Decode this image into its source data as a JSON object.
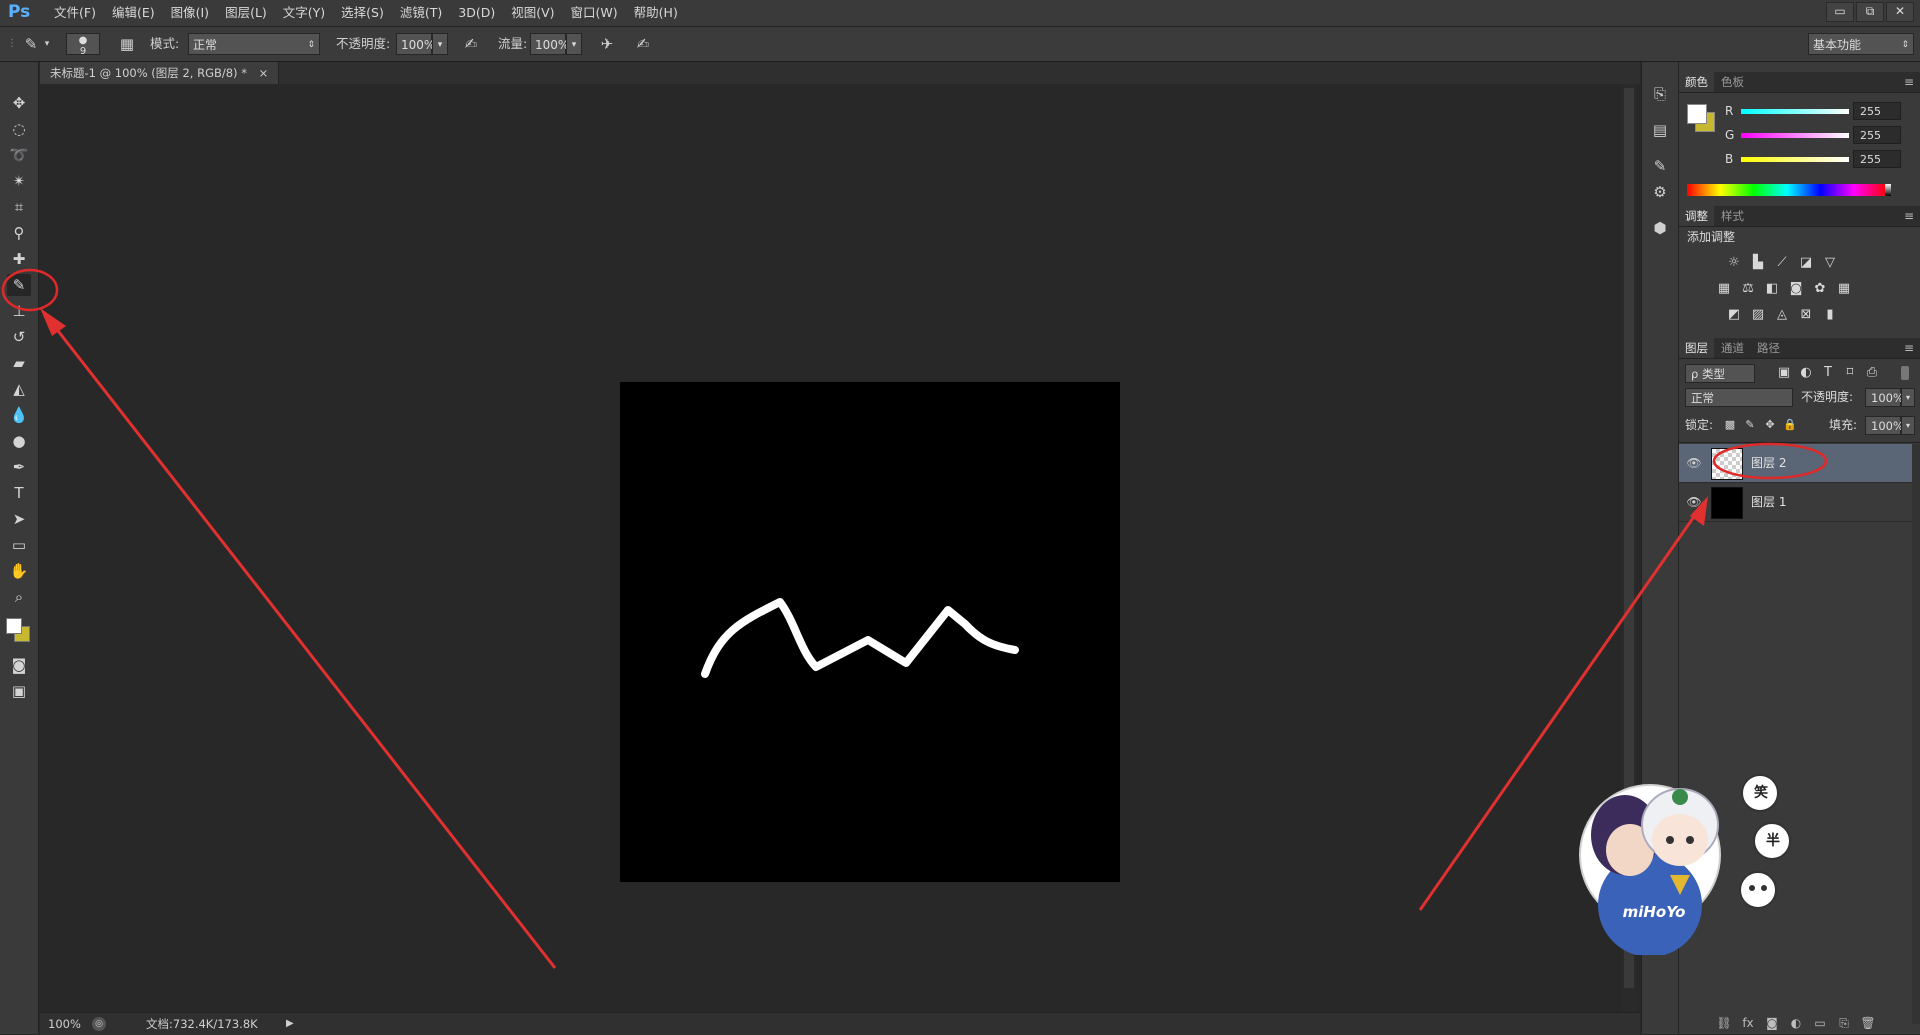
{
  "app": {
    "logo": "Ps"
  },
  "menu": [
    "文件(F)",
    "编辑(E)",
    "图像(I)",
    "图层(L)",
    "文字(Y)",
    "选择(S)",
    "滤镜(T)",
    "3D(D)",
    "视图(V)",
    "窗口(W)",
    "帮助(H)"
  ],
  "window_controls": {
    "minimize": "▭",
    "restore": "⧉",
    "close": "✕"
  },
  "options": {
    "brush_size": "9",
    "mode_label": "模式:",
    "mode_value": "正常",
    "opacity_label": "不透明度:",
    "opacity_value": "100%",
    "flow_label": "流量:",
    "flow_value": "100%",
    "workspace": "基本功能"
  },
  "document": {
    "tab_title": "未标题-1 @ 100% (图层 2, RGB/8) *",
    "tab_close": "×"
  },
  "status": {
    "zoom": "100%",
    "doc_info": "文档:732.4K/173.8K"
  },
  "color_panel": {
    "tabs": [
      "颜色",
      "色板"
    ],
    "r_label": "R",
    "g_label": "G",
    "b_label": "B",
    "r": "255",
    "g": "255",
    "b": "255",
    "foreground": "#ffffff",
    "background": "#c8b830"
  },
  "adjust_panel": {
    "tabs": [
      "调整",
      "样式"
    ],
    "heading": "添加调整"
  },
  "layers_panel": {
    "tabs": [
      "图层",
      "通道",
      "路径"
    ],
    "filter_kind": "ρ 类型",
    "blend_mode": "正常",
    "opacity_label": "不透明度:",
    "opacity_value": "100%",
    "lock_label": "锁定:",
    "fill_label": "填充:",
    "fill_value": "100%",
    "layers": [
      {
        "name": "图层 2",
        "selected": true
      },
      {
        "name": "图层 1",
        "selected": false
      }
    ]
  },
  "mascot": {
    "bubble1": "笑",
    "bubble2": "半",
    "logo": "miHoYo"
  },
  "icons": {
    "eye": "eye-icon",
    "brush": "brush-icon"
  }
}
